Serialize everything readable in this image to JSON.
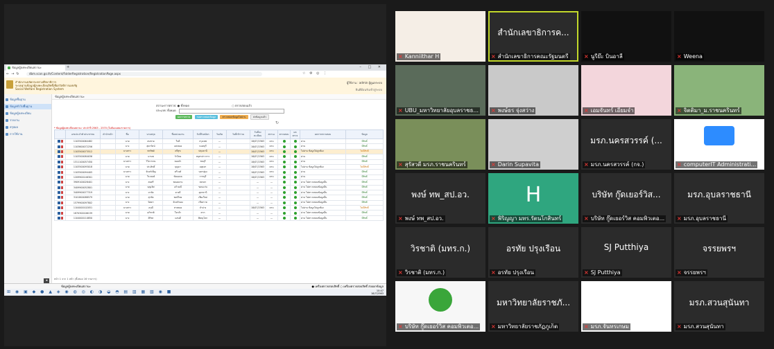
{
  "browser": {
    "tab_title": "ข้อมูลผู้ลงทะเบียนสถานะ",
    "url": "dbm.scan.go.th/Content/FolderRegistration/RegistrationPage.aspx",
    "window_buttons": "– □ ✕"
  },
  "app": {
    "title_line1": "สำนักงานปลัดกระทรวงศึกษาธิการ",
    "title_line2": "ระบบฐานข้อมูลผู้ลงทะเบียนสิทธิ์เพื่อสวัสดิการแห่งรัฐ",
    "title_line3": "Social Welfare Registration System",
    "user": "ผู้ใช้งาน : admin ผู้ดูแลระบบ",
    "user_sub": "ยินดีต้อนรับเข้าสู่ระบบ"
  },
  "sidebar": {
    "items": [
      {
        "label": "ข้อมูลพื้นฐาน"
      },
      {
        "label": "ข้อมูลทั่วไปพื้นฐาน"
      },
      {
        "label": "ข้อมูลผู้ลงทะเบียน"
      },
      {
        "label": "รายงาน"
      },
      {
        "label": "สรุปผล"
      },
      {
        "label": "การใช้งาน"
      }
    ]
  },
  "main": {
    "breadcrumb": "ข้อมูลผู้ลงทะเบียนสถานะ",
    "filter_label": "สถานะการตรวจ:",
    "filter_opt1": "● ทั้งหมด",
    "filter_opt2": "○ ตรวจสอบแล้ว",
    "filter_row2": "ประเภท: ทั้งหมด",
    "tabs": [
      "ผลการตรวจ",
      "รอตรวจสอบข้อมูล",
      "ตรวจสอบข้อมูลไม่ผ่าน",
      "ส่งข้อมูลแล้ว"
    ],
    "warning": "* ข้อมูลผู้ลงทะเบียนสถานะ ประจำปี 2563 - 2570 (ไม่ต้องแสดงรายการ)",
    "headers": [
      "",
      "เลขประจำตัวประชาชน",
      "คำนำหน้า",
      "ชื่อ",
      "นามสกุล",
      "ชื่อหน่วยงาน",
      "วันที่รับสมัคร",
      "วันเกิด",
      "วันที่เข้าร่วม",
      "วันที่ลงทะเบียน",
      "สถานะ",
      "ตรวจสอบ",
      "ผลตรวจ",
      "ผลการตรวจสอบ",
      "ข้อมูล"
    ],
    "rows": [
      {
        "id": "1103500064482",
        "p": "นาย",
        "f": "สมชาย",
        "l": "ใจดี",
        "org": "กรุงเทพ",
        "d1": "—",
        "d2": "18/07/2563",
        "d3": "ครบ",
        "r": "ผ่าน",
        "s": "มีสิทธิ์",
        "hl": false
      },
      {
        "id": "1103600072256",
        "p": "นาง",
        "f": "สุดารัตน์",
        "l": "แสงทอง",
        "org": "นนทบุรี",
        "d1": "—",
        "d2": "18/07/2563",
        "d3": "ครบ",
        "r": "ผ่าน",
        "s": "มีสิทธิ์",
        "hl": false
      },
      {
        "id": "1103500073512",
        "p": "นางสาว",
        "f": "พรทิพย์",
        "l": "ศรีสุข",
        "org": "ปทุมธานี",
        "d1": "—",
        "d2": "18/07/2563",
        "d3": "ครบ",
        "r": "ไม่ผ่าน ข้อมูลไม่ถูกต้อง",
        "s": "ไม่มีสิทธิ์",
        "hl": true
      },
      {
        "id": "1103500084036",
        "p": "นาย",
        "f": "มานพ",
        "l": "รักไทย",
        "org": "สมุทรปราการ",
        "d1": "—",
        "d2": "18/07/2563",
        "d3": "ครบ",
        "r": "ผ่าน",
        "s": "มีสิทธิ์",
        "hl": false
      },
      {
        "id": "1311100057450",
        "p": "นางสาว",
        "f": "วิไลวรรณ",
        "l": "ทองคำ",
        "org": "ชลบุรี",
        "d1": "—",
        "d2": "18/07/2563",
        "d3": "ครบ",
        "r": "ผ่าน",
        "s": "มีสิทธิ์",
        "hl": false
      },
      {
        "id": "1103500093018",
        "p": "นาย",
        "f": "ประสิทธิ์",
        "l": "บุญมา",
        "org": "อยุธยา",
        "d1": "—",
        "d2": "18/07/2563",
        "d3": "ครบ",
        "r": "ไม่ผ่าน ข้อมูลไม่ถูกต้อง",
        "s": "ไม่มีสิทธิ์",
        "hl": false
      },
      {
        "id": "1103500094405",
        "p": "นางสาว",
        "f": "จันทร์เพ็ญ",
        "l": "ศรีวงศ์",
        "org": "นครปฐม",
        "d1": "—",
        "d2": "18/07/2563",
        "d3": "ครบ",
        "r": "ผ่าน",
        "s": "มีสิทธิ์",
        "hl": false
      },
      {
        "id": "1209900146301",
        "p": "นาย",
        "f": "วีระพงษ์",
        "l": "ชัยมงคล",
        "org": "ราชบุรี",
        "d1": "—",
        "d2": "18/07/2563",
        "d3": "ครบ",
        "r": "ผ่าน",
        "s": "มีสิทธิ์",
        "hl": false
      },
      {
        "id": "3909100028401",
        "p": "นาง",
        "f": "สมศรี",
        "l": "พลอยงาม",
        "org": "สงขลา",
        "d1": "—",
        "d2": "—",
        "d3": "—",
        "r": "ผ่าน ไม่ตรวจสอบข้อมูลอื่น",
        "s": "มีสิทธิ์",
        "hl": false
      },
      {
        "id": "3409900052801",
        "p": "นาย",
        "f": "บุญเลิศ",
        "l": "แก้วมณี",
        "org": "ขอนแก่น",
        "d1": "—",
        "d2": "—",
        "d3": "—",
        "r": "ผ่าน ไม่ตรวจสอบข้อมูลอื่น",
        "s": "มีสิทธิ์",
        "hl": false
      },
      {
        "id": "3409900077319",
        "p": "นาง",
        "f": "มาลัย",
        "l": "ดวงดี",
        "org": "อุดรธานี",
        "d1": "—",
        "d2": "—",
        "d3": "—",
        "r": "ผ่าน ไม่ตรวจสอบข้อมูลอื่น",
        "s": "มีสิทธิ์",
        "hl": false
      },
      {
        "id": "3101800088579",
        "p": "นาย",
        "f": "สุรชัย",
        "l": "พงษ์ไทย",
        "org": "เชียงใหม่",
        "d1": "—",
        "d2": "—",
        "d3": "—",
        "r": "ผ่าน ไม่ตรวจสอบข้อมูลอื่น",
        "s": "มีสิทธิ์",
        "hl": false
      },
      {
        "id": "1579900097802",
        "p": "นาง",
        "f": "นิตยา",
        "l": "จันทร์หอม",
        "org": "เชียงราย",
        "d1": "—",
        "d2": "—",
        "d3": "—",
        "r": "ผ่าน ไม่ตรวจสอบข้อมูลอื่น",
        "s": "มีสิทธิ์",
        "hl": false
      },
      {
        "id": "1104000102051",
        "p": "นางสาว",
        "f": "อรุณี",
        "l": "สายทอง",
        "org": "ลำปาง",
        "d1": "—",
        "d2": "18/07/2563",
        "d3": "ครบ",
        "r": "ไม่ผ่าน ข้อมูลไม่ถูกต้อง",
        "s": "ไม่มีสิทธิ์",
        "hl": false
      },
      {
        "id": "1870300106139",
        "p": "นาย",
        "f": "อภิชาติ",
        "l": "ใจกล้า",
        "org": "ตาก",
        "d1": "—",
        "d2": "—",
        "d3": "—",
        "r": "ผ่าน ไม่ตรวจสอบข้อมูลอื่น",
        "s": "มีสิทธิ์",
        "hl": false
      },
      {
        "id": "1104000110850",
        "p": "นาง",
        "f": "ศิริพร",
        "l": "แสนดี",
        "org": "พิษณุโลก",
        "d1": "—",
        "d2": "—",
        "d3": "—",
        "r": "ผ่าน ไม่ตรวจสอบข้อมูลอื่น",
        "s": "มีสิทธิ์",
        "hl": false
      }
    ],
    "pager": "หน้า 1 จาก 1 หน้า (ทั้งหมด 16 รายการ)"
  },
  "statusbar": {
    "left": "ข้อมูลผู้ลงทะเบียนสถานะ",
    "right1": "● เครื่องตรวจสอบสิทธิ์",
    "right2": "○ เครื่องตรวจสอบสิทธิ์",
    "right3": "ส่งออกข้อมูล"
  },
  "taskbar": {
    "icons": "⊞ ◉ ▣ ◆ ● ▲ ◈ ◉ ◍ ◎ ◐ ◑ ◒ ◓ ▤ ▥ ▦ ▧ ◉ ■",
    "time": "10:47",
    "date": "18/7/2563"
  },
  "gallery": {
    "tiles": [
      {
        "name": "Kanniithar H",
        "big": ""
      },
      {
        "name": "สำนักเลขาธิการคณะรัฐมนตรี",
        "big": "สำนักเลขาธิการค..."
      },
      {
        "name": "นูรีย๊ะ บินอาลี",
        "big": ""
      },
      {
        "name": "Weena",
        "big": ""
      },
      {
        "name": "UBU_มหาวิทยาลัยอุบลราชธ...",
        "big": ""
      },
      {
        "name": "พงษ์ธร จุ่งสว่าง",
        "big": ""
      },
      {
        "name": "เอมจันทร์ เอี่ยมจำ",
        "big": ""
      },
      {
        "name": "จิตติมา_ม.ราชนครินทร์",
        "big": ""
      },
      {
        "name": "สุรัสวดี มรภ.ราชนครินทร์",
        "big": ""
      },
      {
        "name": "Darin Supavita",
        "big": ""
      },
      {
        "name": "มรภ.นครสวรรค์ (กจ.)",
        "big": "มรภ.นครสวรรค์ (..."
      },
      {
        "name": "computerIT Administrati...",
        "big": ""
      },
      {
        "name": "พงษ์ ทพ_สป.อว.",
        "big": "พงษ์ ทพ_สป.อว."
      },
      {
        "name": "พิริญญา มทร.รัตนโกสินทร์",
        "big": ""
      },
      {
        "name": "บริษัท กู๊ดเยอร์วิส คอมพิวเตอ...",
        "big": "บริษัท กู๊ดเยอร์วิส..."
      },
      {
        "name": "มรภ.อุบลราชธานี",
        "big": "มรภ.อุบลราชธานี"
      },
      {
        "name": "วิรชาติ (มทร.ก.)",
        "big": "วิรชาติ (มทร.ก.)"
      },
      {
        "name": "อรทัย ปรุงเรือน",
        "big": "อรทัย ปรุงเรือน"
      },
      {
        "name": "SJ Putthiya",
        "big": "SJ Putthiya"
      },
      {
        "name": "จรรยพรฯ",
        "big": "จรรยพรฯ"
      },
      {
        "name": "บริษัท กู๊ดเยอร์วิส คอมพิวเตอ...",
        "big": ""
      },
      {
        "name": "มหาวิทยาลัยราชภัฏภูเก็ต",
        "big": "มหาวิทยาลัยราชภั..."
      },
      {
        "name": "มรภ.จันทรเกษม",
        "big": ""
      },
      {
        "name": "มรภ.สวนสุนันทา",
        "big": "มรภ.สวนสุนันทา"
      }
    ],
    "colors": {
      "active_outline": "#c3d92b",
      "zoom_blue": "#2d8cff",
      "green_tile": "#2fa67f"
    }
  }
}
